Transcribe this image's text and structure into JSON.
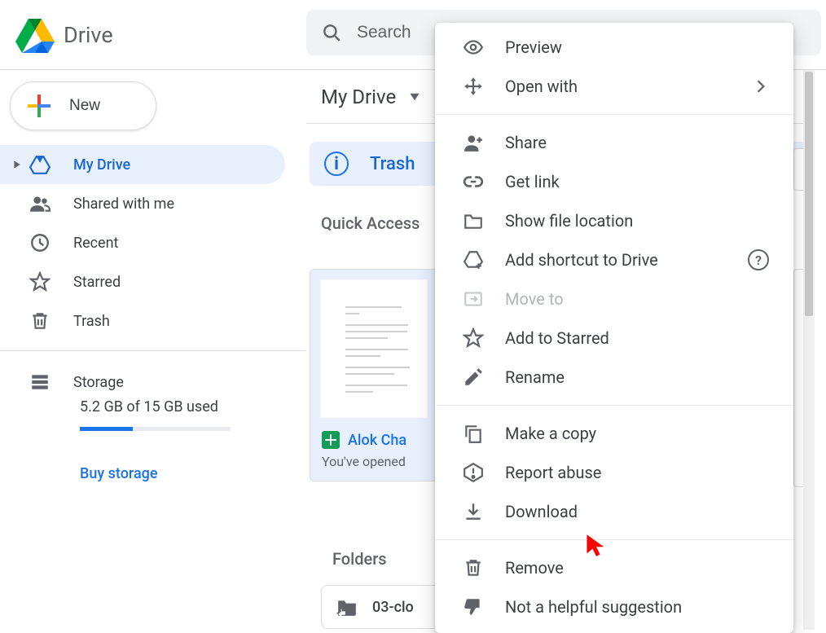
{
  "app": {
    "name": "Drive"
  },
  "search": {
    "placeholder": "Search"
  },
  "new_button": {
    "label": "New"
  },
  "sidebar": {
    "items": [
      {
        "label": "My Drive"
      },
      {
        "label": "Shared with me"
      },
      {
        "label": "Recent"
      },
      {
        "label": "Starred"
      },
      {
        "label": "Trash"
      }
    ],
    "storage": {
      "label": "Storage",
      "usage_text": "5.2 GB of 15 GB used",
      "percent": 35,
      "buy_label": "Buy storage"
    }
  },
  "main": {
    "breadcrumb": "My Drive",
    "banner_text": "Trash",
    "quick_access_heading": "Quick Access",
    "qa_card": {
      "title": "Alok Cha",
      "subtitle": "You've opened"
    },
    "folders_heading": "Folders",
    "folder_chip_label": "03-clo"
  },
  "context_menu": {
    "items": [
      {
        "label": "Preview",
        "icon": "eye"
      },
      {
        "label": "Open with",
        "icon": "move-arrows",
        "has_submenu": true
      },
      {
        "divider": true
      },
      {
        "label": "Share",
        "icon": "person-add"
      },
      {
        "label": "Get link",
        "icon": "link"
      },
      {
        "label": "Show file location",
        "icon": "folder"
      },
      {
        "label": "Add shortcut to Drive",
        "icon": "drive-add",
        "help": true
      },
      {
        "label": "Move to",
        "icon": "move-to",
        "disabled": true
      },
      {
        "label": "Add to Starred",
        "icon": "star"
      },
      {
        "label": "Rename",
        "icon": "pencil"
      },
      {
        "divider": true
      },
      {
        "label": "Make a copy",
        "icon": "copy"
      },
      {
        "label": "Report abuse",
        "icon": "alert"
      },
      {
        "label": "Download",
        "icon": "download"
      },
      {
        "divider": true
      },
      {
        "label": "Remove",
        "icon": "trash"
      },
      {
        "label": "Not a helpful suggestion",
        "icon": "thumb-down"
      }
    ]
  }
}
